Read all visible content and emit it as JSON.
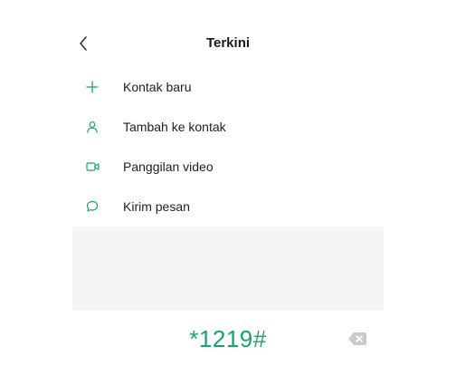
{
  "header": {
    "title": "Terkini"
  },
  "menu": {
    "items": [
      {
        "label": "Kontak baru",
        "icon": "plus-icon"
      },
      {
        "label": "Tambah ke kontak",
        "icon": "person-icon"
      },
      {
        "label": "Panggilan video",
        "icon": "video-camera-icon"
      },
      {
        "label": "Kirim pesan",
        "icon": "message-bubble-icon"
      }
    ]
  },
  "dialer": {
    "number": "*1219#"
  },
  "colors": {
    "accent": "#1aa36b",
    "panel": "#f5f5f5",
    "text": "#1f1f1f",
    "icon_gray": "#c9c9c9"
  }
}
